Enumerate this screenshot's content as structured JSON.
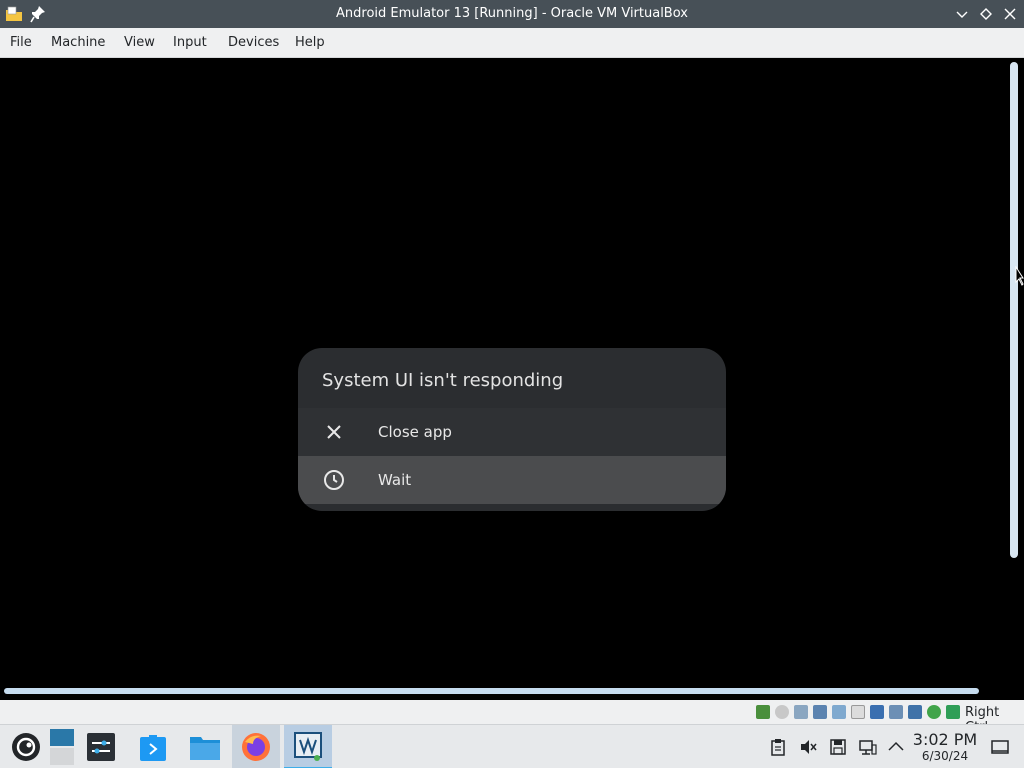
{
  "window": {
    "title": "Android Emulator 13 [Running] - Oracle VM VirtualBox",
    "app_icon": "folder-note-icon",
    "pin_icon": "pin-icon",
    "controls": [
      "minimize-icon",
      "maximize-icon",
      "close-icon"
    ]
  },
  "menu": {
    "items": [
      "File",
      "Machine",
      "View",
      "Input",
      "Devices",
      "Help"
    ]
  },
  "dialog": {
    "title": "System UI isn't responding",
    "options": [
      {
        "label": "Close app",
        "icon": "close-icon"
      },
      {
        "label": "Wait",
        "icon": "clock-icon"
      }
    ]
  },
  "vbox_status": {
    "host_key": "Right Ctrl",
    "icons": [
      "hard-disk-icon",
      "optical-drive-icon",
      "audio-icon",
      "network-icon",
      "usb-icon",
      "shared-folders-icon",
      "display-icon",
      "video-capture-icon",
      "processor-icon",
      "mouse-integration-icon",
      "keyboard-icon"
    ]
  },
  "taskbar": {
    "apps": [
      "opensuse-launcher-icon",
      "pager-icon",
      "settings-icon",
      "discover-icon",
      "file-manager-icon",
      "firefox-icon",
      "virtualbox-icon"
    ],
    "tray": [
      "clipboard-icon",
      "volume-muted-icon",
      "storage-icon",
      "network-icon",
      "show-hidden-icon"
    ],
    "time": "3:02 PM",
    "date": "6/30/24",
    "show_desktop_icon": "show-desktop-icon"
  },
  "colors": {
    "titlebar": "#475057",
    "dialog_bg": "#2b2d30",
    "wait_highlight": "#4b4c4e",
    "accent": "#3daee9"
  }
}
